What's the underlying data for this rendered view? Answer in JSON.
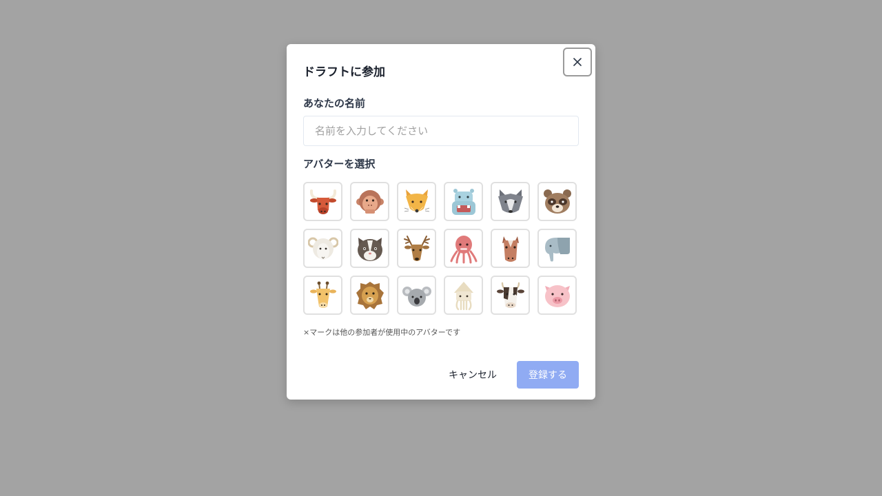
{
  "modal": {
    "title": "ドラフトに参加",
    "close_icon": "close-icon"
  },
  "name_field": {
    "label": "あなたの名前",
    "value": "",
    "placeholder": "名前を入力してください"
  },
  "avatar_section": {
    "label": "アバターを選択",
    "note": "×マークは他の参加者が使用中のアバターです",
    "avatars": [
      {
        "icon": "bull-icon"
      },
      {
        "icon": "monkey-icon"
      },
      {
        "icon": "fox-icon"
      },
      {
        "icon": "hippo-icon"
      },
      {
        "icon": "wolf-icon"
      },
      {
        "icon": "raccoon-dog-icon"
      },
      {
        "icon": "sheep-icon"
      },
      {
        "icon": "cat-icon"
      },
      {
        "icon": "deer-icon"
      },
      {
        "icon": "octopus-icon"
      },
      {
        "icon": "horse-icon"
      },
      {
        "icon": "elephant-icon"
      },
      {
        "icon": "giraffe-icon"
      },
      {
        "icon": "lion-icon"
      },
      {
        "icon": "koala-icon"
      },
      {
        "icon": "squid-icon"
      },
      {
        "icon": "cow-icon"
      },
      {
        "icon": "pig-icon"
      }
    ]
  },
  "footer": {
    "cancel_label": "キャンセル",
    "submit_label": "登録する"
  },
  "colors": {
    "overlay": "#a3a3a3",
    "submit_button": "#90abf3"
  }
}
